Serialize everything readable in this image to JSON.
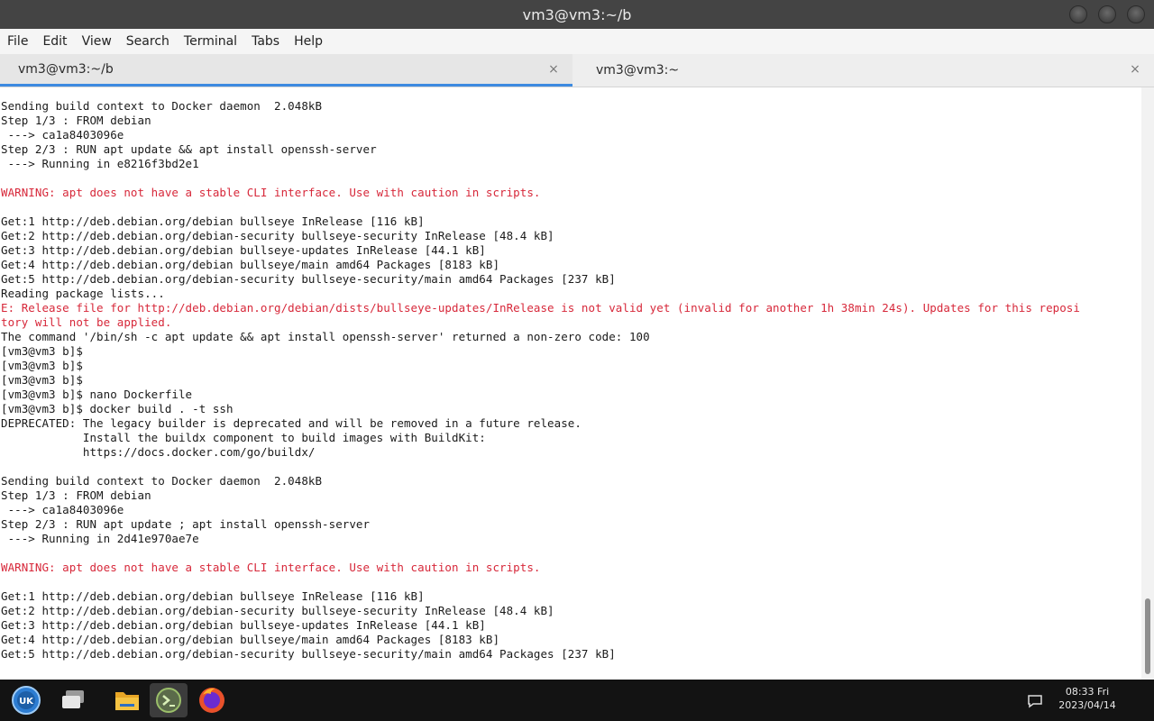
{
  "window": {
    "title": "vm3@vm3:~/b"
  },
  "menu": [
    "File",
    "Edit",
    "View",
    "Search",
    "Terminal",
    "Tabs",
    "Help"
  ],
  "tabs": [
    {
      "label": "vm3@vm3:~/b",
      "close": "×"
    },
    {
      "label": "vm3@vm3:~",
      "close": "×"
    }
  ],
  "terminal": {
    "lines": [
      {
        "text": "Sending build context to Docker daemon  2.048kB",
        "type": "normal"
      },
      {
        "text": "Step 1/3 : FROM debian",
        "type": "normal"
      },
      {
        "text": " ---> ca1a8403096e",
        "type": "normal"
      },
      {
        "text": "Step 2/3 : RUN apt update && apt install openssh-server",
        "type": "normal"
      },
      {
        "text": " ---> Running in e8216f3bd2e1",
        "type": "normal"
      },
      {
        "text": "",
        "type": "normal"
      },
      {
        "text": "WARNING: apt does not have a stable CLI interface. Use with caution in scripts.",
        "type": "warn"
      },
      {
        "text": "",
        "type": "normal"
      },
      {
        "text": "Get:1 http://deb.debian.org/debian bullseye InRelease [116 kB]",
        "type": "normal"
      },
      {
        "text": "Get:2 http://deb.debian.org/debian-security bullseye-security InRelease [48.4 kB]",
        "type": "normal"
      },
      {
        "text": "Get:3 http://deb.debian.org/debian bullseye-updates InRelease [44.1 kB]",
        "type": "normal"
      },
      {
        "text": "Get:4 http://deb.debian.org/debian bullseye/main amd64 Packages [8183 kB]",
        "type": "normal"
      },
      {
        "text": "Get:5 http://deb.debian.org/debian-security bullseye-security/main amd64 Packages [237 kB]",
        "type": "normal"
      },
      {
        "text": "Reading package lists...",
        "type": "normal"
      },
      {
        "text": "E: Release file for http://deb.debian.org/debian/dists/bullseye-updates/InRelease is not valid yet (invalid for another 1h 38min 24s). Updates for this reposi",
        "type": "warn"
      },
      {
        "text": "tory will not be applied.",
        "type": "warn"
      },
      {
        "text": "The command '/bin/sh -c apt update && apt install openssh-server' returned a non-zero code: 100",
        "type": "normal"
      },
      {
        "text": "[vm3@vm3 b]$",
        "type": "normal"
      },
      {
        "text": "[vm3@vm3 b]$",
        "type": "normal"
      },
      {
        "text": "[vm3@vm3 b]$",
        "type": "normal"
      },
      {
        "text": "[vm3@vm3 b]$ nano Dockerfile",
        "type": "normal"
      },
      {
        "text": "[vm3@vm3 b]$ docker build . -t ssh",
        "type": "normal"
      },
      {
        "text": "DEPRECATED: The legacy builder is deprecated and will be removed in a future release.",
        "type": "normal"
      },
      {
        "text": "            Install the buildx component to build images with BuildKit:",
        "type": "normal"
      },
      {
        "text": "            https://docs.docker.com/go/buildx/",
        "type": "normal"
      },
      {
        "text": "",
        "type": "normal"
      },
      {
        "text": "Sending build context to Docker daemon  2.048kB",
        "type": "normal"
      },
      {
        "text": "Step 1/3 : FROM debian",
        "type": "normal"
      },
      {
        "text": " ---> ca1a8403096e",
        "type": "normal"
      },
      {
        "text": "Step 2/3 : RUN apt update ; apt install openssh-server",
        "type": "normal"
      },
      {
        "text": " ---> Running in 2d41e970ae7e",
        "type": "normal"
      },
      {
        "text": "",
        "type": "normal"
      },
      {
        "text": "WARNING: apt does not have a stable CLI interface. Use with caution in scripts.",
        "type": "warn"
      },
      {
        "text": "",
        "type": "normal"
      },
      {
        "text": "Get:1 http://deb.debian.org/debian bullseye InRelease [116 kB]",
        "type": "normal"
      },
      {
        "text": "Get:2 http://deb.debian.org/debian-security bullseye-security InRelease [48.4 kB]",
        "type": "normal"
      },
      {
        "text": "Get:3 http://deb.debian.org/debian bullseye-updates InRelease [44.1 kB]",
        "type": "normal"
      },
      {
        "text": "Get:4 http://deb.debian.org/debian bullseye/main amd64 Packages [8183 kB]",
        "type": "normal"
      },
      {
        "text": "Get:5 http://deb.debian.org/debian-security bullseye-security/main amd64 Packages [237 kB]",
        "type": "normal"
      }
    ]
  },
  "taskbar": {
    "apps": [
      {
        "name": "start-menu-icon"
      },
      {
        "name": "show-desktop-icon"
      },
      {
        "name": "file-manager-icon"
      },
      {
        "name": "terminal-app-icon"
      },
      {
        "name": "firefox-icon"
      }
    ],
    "clock": {
      "time": "08:33 Fri",
      "date": "2023/04/14"
    }
  },
  "colors": {
    "titlebar": "#444444",
    "warning_text": "#d7283a",
    "active_tab_indicator": "#3d8ae0",
    "taskbar": "#131313"
  }
}
